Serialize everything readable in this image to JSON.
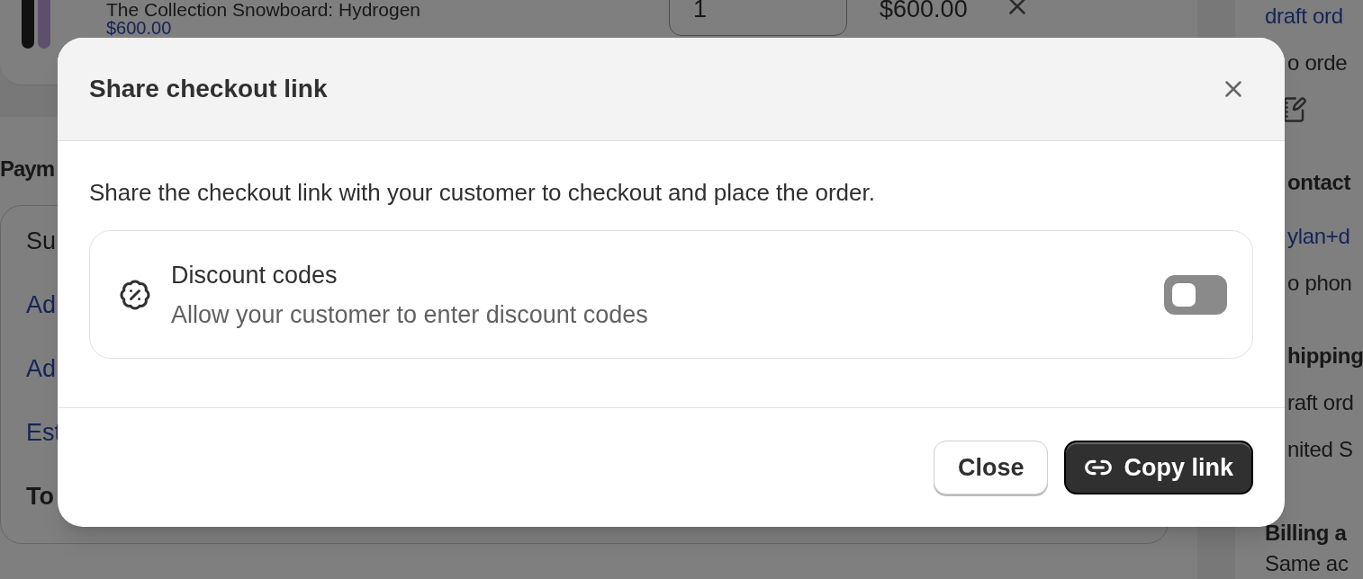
{
  "background": {
    "product": {
      "title": "The Collection Snowboard: Hydrogen",
      "price": "$600.00",
      "quantity": "1",
      "line_total": "$600.00"
    },
    "payment": {
      "heading": "Paym",
      "rows": [
        {
          "label": "Su",
          "kind": "plain"
        },
        {
          "label": "Ad",
          "kind": "link"
        },
        {
          "label": "Ad",
          "kind": "link"
        },
        {
          "label": "Est",
          "kind": "link"
        },
        {
          "label": "To",
          "kind": "total"
        }
      ]
    },
    "sidebar": {
      "items": [
        {
          "text": "draft ord",
          "kind": "link"
        },
        {
          "text": "o orde",
          "kind": "text"
        },
        {
          "kind": "note-icon"
        },
        {
          "text": "ontact",
          "kind": "heading"
        },
        {
          "text": "ylan+d",
          "kind": "link"
        },
        {
          "text": "o phon",
          "kind": "text"
        },
        {
          "text": "hipping",
          "kind": "heading"
        },
        {
          "text": "raft ord",
          "kind": "text"
        },
        {
          "text": "nited S",
          "kind": "text"
        },
        {
          "text": "Billing a",
          "kind": "heading"
        },
        {
          "text": "Same ac",
          "kind": "text"
        }
      ]
    }
  },
  "dialog": {
    "title": "Share checkout link",
    "message": "Share the checkout link with your customer to checkout and place the order.",
    "option": {
      "title": "Discount codes",
      "description": "Allow your customer to enter discount codes",
      "on": false
    },
    "buttons": [
      {
        "label": "Close",
        "kind": "secondary"
      },
      {
        "label": "Copy link",
        "kind": "primary"
      }
    ]
  }
}
